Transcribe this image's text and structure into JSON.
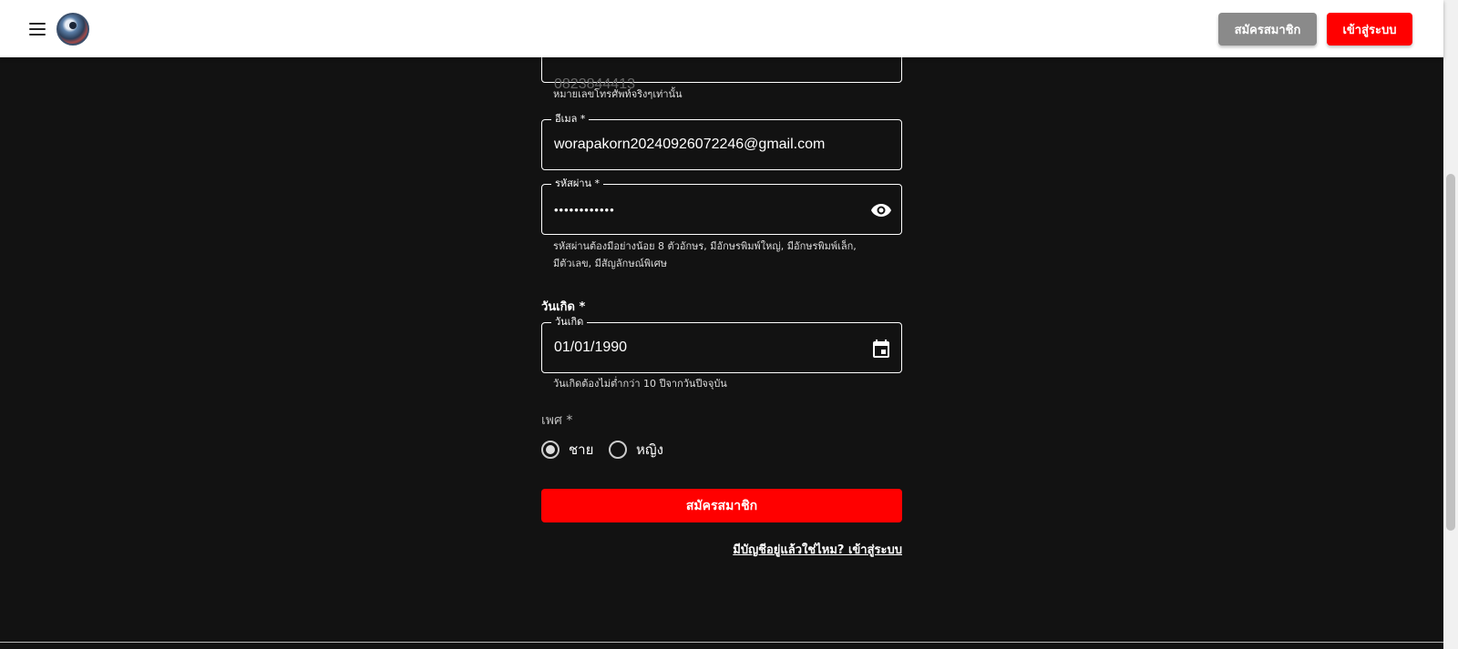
{
  "header": {
    "register_label": "สมัครสมาชิก",
    "login_label": "เข้าสู่ระบบ"
  },
  "phone": {
    "value": "0823844413",
    "helper": "หมายเลขโทรศัพท์จริงๆเท่านั้น"
  },
  "email": {
    "label": "อีเมล *",
    "value": "worapakorn20240926072246@gmail.com"
  },
  "password": {
    "label": "รหัสผ่าน *",
    "value": "••••••••••••",
    "helper_line1": "รหัสผ่านต้องมีอย่างน้อย 8 ตัวอักษร, มีอักษรพิมพ์ใหญ่, มีอักษรพิมพ์เล็ก,",
    "helper_line2": "มีตัวเลข, มีสัญลักษณ์พิเศษ"
  },
  "birthday": {
    "section_label": "วันเกิด *",
    "field_label": "วันเกิด",
    "value": "01/01/1990",
    "helper": "วันเกิดต้องไม่ต่ำกว่า 10 ปีจากวันปีจจุบัน"
  },
  "gender": {
    "label": "เพศ *",
    "options": [
      {
        "label": "ชาย",
        "checked": true
      },
      {
        "label": "หญิง",
        "checked": false
      }
    ]
  },
  "submit_label": "สมัครสมาชิก",
  "login_link": "มีบัญชีอยู่แล้วใช่ไหม? เข้าสู่ระบบ",
  "colors": {
    "accent": "#ff0000",
    "background": "#121212",
    "secondary_button": "#8a8a8a"
  }
}
